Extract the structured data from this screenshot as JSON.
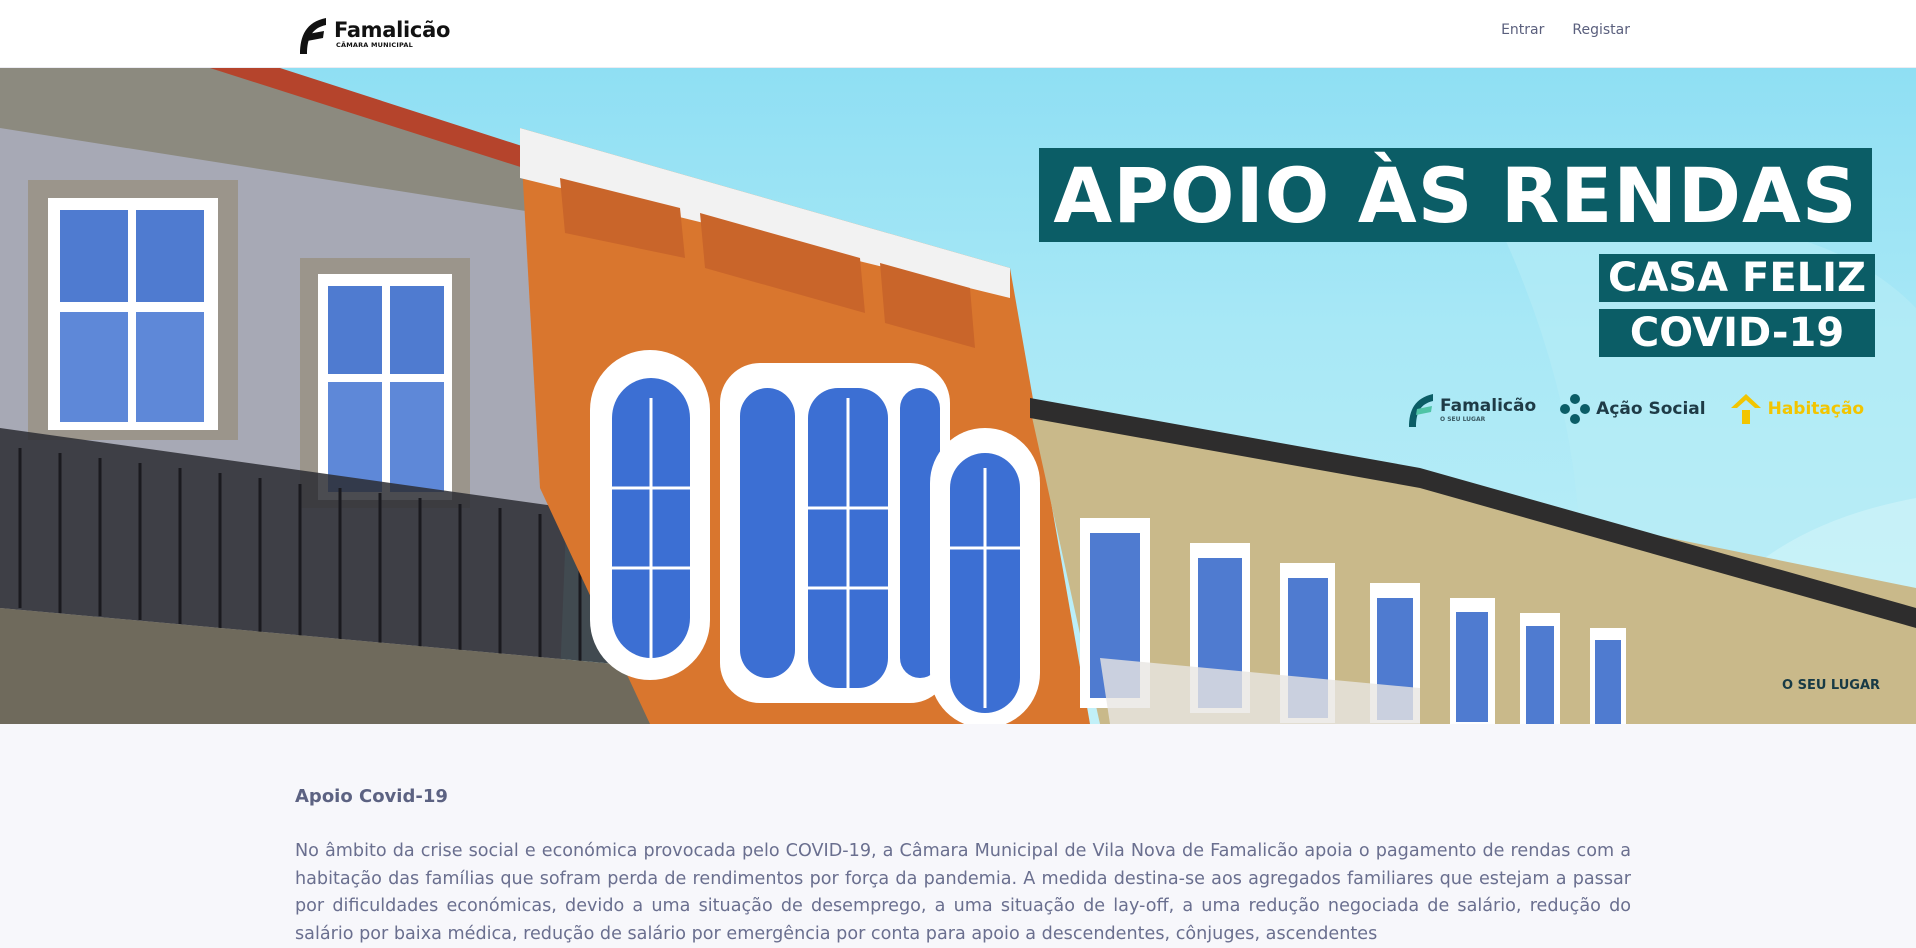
{
  "header": {
    "logo": {
      "name": "Famalicão",
      "subtitle": "CÂMARA MUNICIPAL"
    },
    "nav": {
      "login_label": "Entrar",
      "register_label": "Registar"
    }
  },
  "hero": {
    "banner_title": "APOIO ÀS RENDAS",
    "banner_line_1": "CASA FELIZ",
    "banner_line_2": "COVID-19",
    "partners": [
      {
        "name": "Famalicão",
        "sub": "O SEU LUGAR",
        "icon": "famalicao-logo-icon"
      },
      {
        "name": "Ação Social",
        "icon": "acao-social-icon"
      },
      {
        "name": "Habitação",
        "icon": "habitacao-house-icon"
      }
    ],
    "tagline": "O SEU LUGAR",
    "colors": {
      "banner_bg": "#0b5d66",
      "sky": "#8fdff3",
      "habitacao_yellow": "#f2c500"
    }
  },
  "content": {
    "section_title": "Apoio Covid-19",
    "paragraph": "No âmbito da crise social e económica provocada pelo COVID-19, a Câmara Municipal de Vila Nova de Famalicão apoia o pagamento de rendas com a habitação das famílias que sofram perda de rendimentos por força da  pandemia. A medida destina-se aos agregados familiares que estejam a passar por dificuldades económicas, devido a uma situação de desemprego, a uma situação de lay-off, a uma redução negociada de salário, redução do salário por baixa médica, redução de salário por emergência por conta para apoio a descendentes, cônjuges, ascendentes"
  }
}
